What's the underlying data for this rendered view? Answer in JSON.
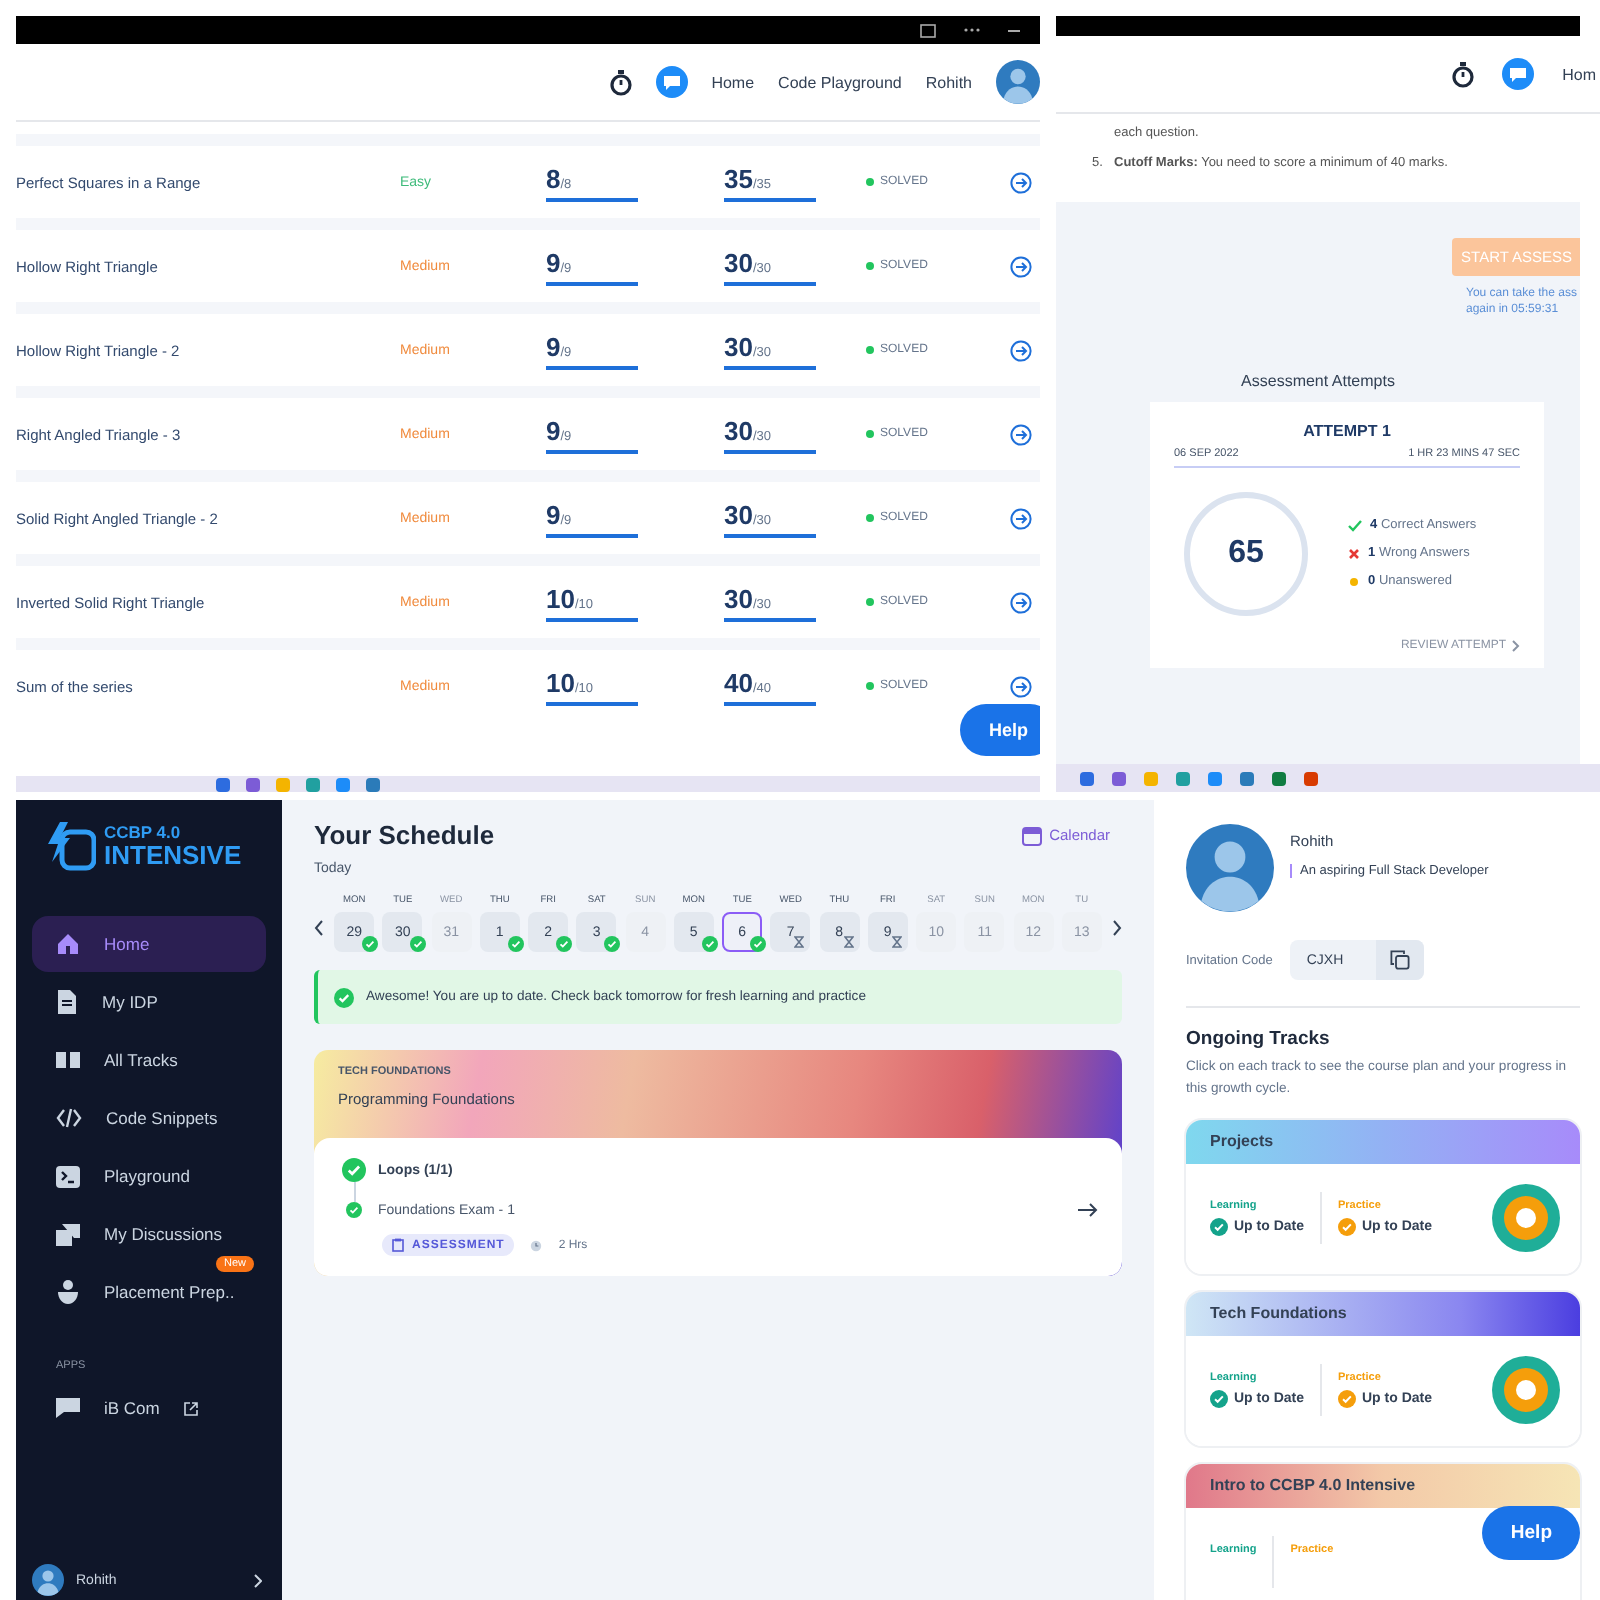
{
  "problems_window": {
    "nav": {
      "links": [
        "Home",
        "Code Playground"
      ],
      "user": "Rohith"
    },
    "problems": [
      {
        "name": "Perfect Squares in a Range",
        "difficulty": "Easy",
        "color": "#3dbb7a",
        "score": {
          "value": "8",
          "out_of": "/8",
          "level": 1
        },
        "points": {
          "value": "35",
          "out_of": "/35",
          "level": 1
        },
        "status": "SOLVED"
      },
      {
        "name": "Hollow Right Triangle",
        "difficulty": "Medium",
        "color": "#f08a3c",
        "score": {
          "value": "9",
          "out_of": "/9",
          "level": 1
        },
        "points": {
          "value": "30",
          "out_of": "/30",
          "level": 1
        },
        "status": "SOLVED"
      },
      {
        "name": "Hollow Right Triangle - 2",
        "difficulty": "Medium",
        "color": "#f08a3c",
        "score": {
          "value": "9",
          "out_of": "/9",
          "level": 1
        },
        "points": {
          "value": "30",
          "out_of": "/30",
          "level": 1
        },
        "status": "SOLVED"
      },
      {
        "name": "Right Angled Triangle - 3",
        "difficulty": "Medium",
        "color": "#f08a3c",
        "score": {
          "value": "9",
          "out_of": "/9",
          "level": 1
        },
        "points": {
          "value": "30",
          "out_of": "/30",
          "level": 1
        },
        "status": "SOLVED"
      },
      {
        "name": "Solid Right Angled Triangle - 2",
        "difficulty": "Medium",
        "color": "#f08a3c",
        "score": {
          "value": "9",
          "out_of": "/9",
          "level": 1
        },
        "points": {
          "value": "30",
          "out_of": "/30",
          "level": 1
        },
        "status": "SOLVED"
      },
      {
        "name": "Inverted Solid Right Triangle",
        "difficulty": "Medium",
        "color": "#f08a3c",
        "score": {
          "value": "10",
          "out_of": "/10",
          "level": 1
        },
        "points": {
          "value": "30",
          "out_of": "/30",
          "level": 1
        },
        "status": "SOLVED"
      },
      {
        "name": "Sum of the series",
        "difficulty": "Medium",
        "color": "#f08a3c",
        "score": {
          "value": "10",
          "out_of": "/10",
          "level": 1
        },
        "points": {
          "value": "40",
          "out_of": "/40",
          "level": 1
        },
        "status": "SOLVED"
      }
    ],
    "help": "Help"
  },
  "assessment_window": {
    "nav": {
      "links": [
        "Hom"
      ]
    },
    "instructions": [
      {
        "text": "each question."
      },
      {
        "number": "5.",
        "text": "**Cutoff Marks:** You need to score a minimum of 40 marks."
      }
    ],
    "start_button": {
      "label": "START ASSESS",
      "disabled": true
    },
    "retake_note": "You can take the ass\nagain in 05:59:31",
    "attempts_title": "Assessment Attempts",
    "attempt": {
      "title": "ATTEMPT 1",
      "date": "06 SEP 2022",
      "duration": "1 HR 23 MINS 47 SEC",
      "score": "65",
      "results": [
        {
          "kind": "correct",
          "count": "4",
          "label": "Correct Answers"
        },
        {
          "kind": "wrong",
          "count": "1",
          "label": "Wrong Answers"
        },
        {
          "kind": "unanswered",
          "count": "0",
          "label": "Unanswered"
        }
      ],
      "review": "REVIEW ATTEMPT"
    }
  },
  "dashboard": {
    "logo": {
      "line1": "CCBP 4.0",
      "line2": "INTENSIVE"
    },
    "sidebar": {
      "items": [
        {
          "label": "Home",
          "selected": true
        },
        {
          "label": "My IDP",
          "selected": false
        },
        {
          "label": "All Tracks",
          "selected": false
        },
        {
          "label": "Code Snippets",
          "selected": false
        },
        {
          "label": "Playground",
          "selected": false
        },
        {
          "label": "My Discussions",
          "selected": false
        },
        {
          "label": "Placement Prep..",
          "selected": false,
          "badge": "New"
        }
      ],
      "apps_heading": "APPS",
      "apps": [
        {
          "label": "iB Com",
          "external": true
        }
      ],
      "user": "Rohith"
    },
    "schedule": {
      "title": "Your Schedule",
      "calendar_link": "Calendar",
      "today": "Today",
      "days": [
        {
          "day": "MON",
          "date": "29",
          "done": true,
          "pending": false,
          "disabled": false,
          "selected": false
        },
        {
          "day": "TUE",
          "date": "30",
          "done": true,
          "pending": false,
          "disabled": false,
          "selected": false
        },
        {
          "day": "WED",
          "date": "31",
          "done": false,
          "pending": false,
          "disabled": true,
          "selected": false
        },
        {
          "day": "THU",
          "date": "1",
          "done": true,
          "pending": false,
          "disabled": false,
          "selected": false
        },
        {
          "day": "FRI",
          "date": "2",
          "done": true,
          "pending": false,
          "disabled": false,
          "selected": false
        },
        {
          "day": "SAT",
          "date": "3",
          "done": true,
          "pending": false,
          "disabled": false,
          "selected": false
        },
        {
          "day": "SUN",
          "date": "4",
          "done": false,
          "pending": false,
          "disabled": true,
          "selected": false
        },
        {
          "day": "MON",
          "date": "5",
          "done": true,
          "pending": false,
          "disabled": false,
          "selected": false
        },
        {
          "day": "TUE",
          "date": "6",
          "done": true,
          "pending": false,
          "disabled": false,
          "selected": true
        },
        {
          "day": "WED",
          "date": "7",
          "done": false,
          "pending": true,
          "disabled": false,
          "selected": false
        },
        {
          "day": "THU",
          "date": "8",
          "done": false,
          "pending": true,
          "disabled": false,
          "selected": false
        },
        {
          "day": "FRI",
          "date": "9",
          "done": false,
          "pending": true,
          "disabled": false,
          "selected": false
        },
        {
          "day": "SAT",
          "date": "10",
          "done": false,
          "pending": false,
          "disabled": true,
          "selected": false
        },
        {
          "day": "SUN",
          "date": "11",
          "done": false,
          "pending": false,
          "disabled": true,
          "selected": false
        },
        {
          "day": "MON",
          "date": "12",
          "done": false,
          "pending": false,
          "disabled": true,
          "selected": false
        },
        {
          "day": "TU",
          "date": "13",
          "done": false,
          "pending": false,
          "disabled": true,
          "selected": false
        }
      ],
      "alert": "Awesome! You are up to date. Check back tomorrow for fresh learning and practice",
      "card": {
        "category": "TECH FOUNDATIONS",
        "title": "Programming Foundations",
        "topic": "Loops (1/1)",
        "item": "Foundations Exam - 1",
        "tag": "ASSESSMENT",
        "duration": "2 Hrs"
      }
    },
    "profile": {
      "name": "Rohith",
      "tagline": "An aspiring Full Stack Developer",
      "invitation_label": "Invitation Code",
      "invitation_code": "CJXH"
    },
    "tracks_title": "Ongoing Tracks",
    "tracks_description": "Click on each track to see the course plan and your progress in this growth cycle.",
    "tracks": [
      {
        "title": "Projects",
        "learning": {
          "label": "Learning",
          "status": "Up to Date"
        },
        "practice": {
          "label": "Practice",
          "status": "Up to Date"
        }
      },
      {
        "title": "Tech Foundations",
        "learning": {
          "label": "Learning",
          "status": "Up to Date"
        },
        "practice": {
          "label": "Practice",
          "status": "Up to Date"
        }
      },
      {
        "title": "Intro to CCBP 4.0 Intensive",
        "learning": {
          "label": "Learning"
        },
        "practice": {
          "label": "Practice"
        }
      }
    ],
    "help": "Help"
  }
}
